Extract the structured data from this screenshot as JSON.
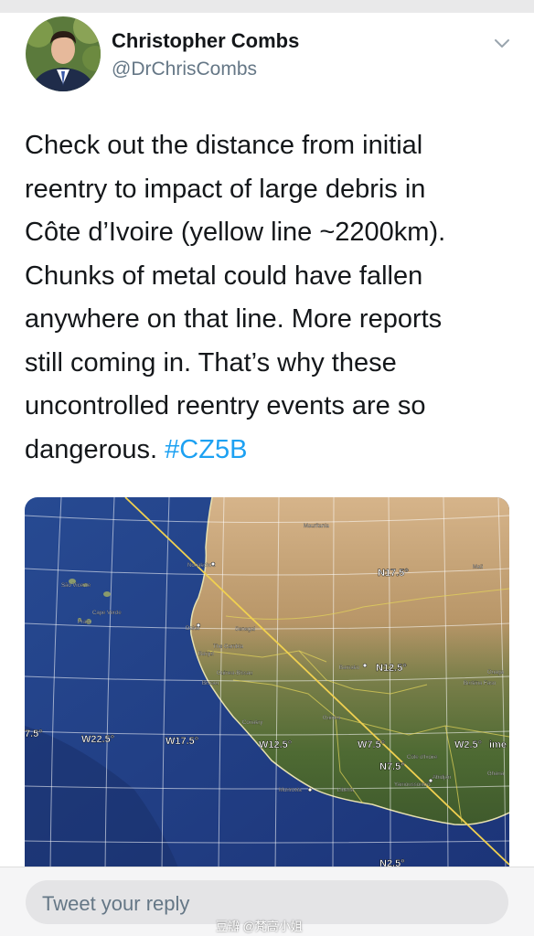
{
  "tweet": {
    "author": {
      "display_name": "Christopher Combs",
      "handle": "@DrChrisCombs"
    },
    "text_lines": [
      "Check out the distance from initial",
      "reentry to impact of large debris in",
      "Côte d’Ivoire (yellow line ~2200km).",
      "Chunks of metal could have fallen",
      "anywhere on that line. More reports",
      "still coming in. That’s why these",
      "uncontrolled reentry events are so"
    ],
    "last_line_text": "dangerous. ",
    "hashtag": "#CZ5B"
  },
  "map": {
    "lat_labels": [
      "N17.5°",
      "N12.5°",
      "N7.5°",
      "N2.5°"
    ],
    "lon_labels": [
      "7.5°",
      "W22.5°",
      "W17.5°",
      "W12.5°",
      "W7.5°",
      "W2.5°"
    ],
    "time_fragment": "ime",
    "places": [
      "Mauritania",
      "Mali",
      "Nouakchott",
      "Senegal",
      "Dakar",
      "The Gambia",
      "Banjul",
      "Guinea-Bissau",
      "Bissau",
      "Conakry",
      "Guinea",
      "Bamako",
      "Burkina Faso",
      "Ouaga",
      "Côte d'Ivoire",
      "Yamoussoukro",
      "Abidjan",
      "Ghana",
      "Monrovia",
      "Liberia",
      "Cape Verde",
      "Praia",
      "São Vicente"
    ]
  },
  "reply": {
    "placeholder": "Tweet your reply",
    "watermark": "豆瓣 @梵高小姐"
  },
  "colors": {
    "hashtag": "#1da1f2",
    "handle": "#657786",
    "track_line": "#f0d050"
  }
}
